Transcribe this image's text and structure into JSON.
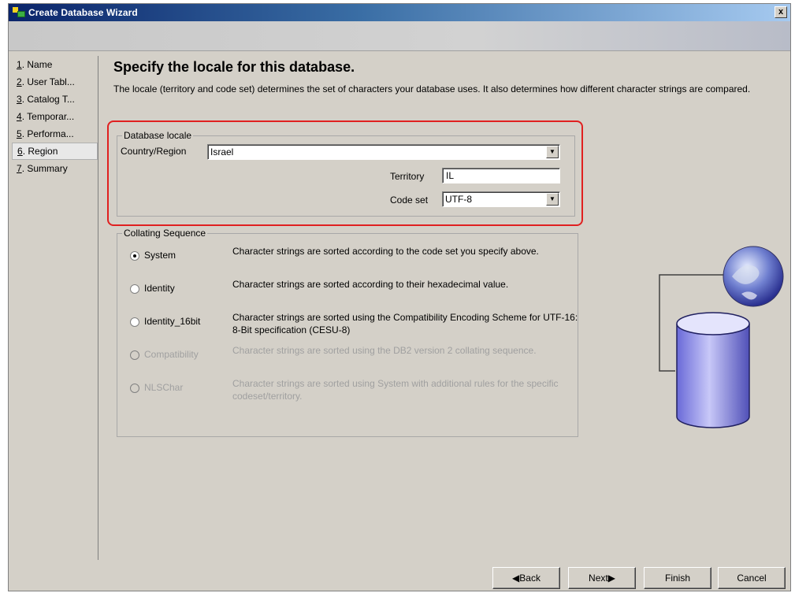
{
  "window": {
    "title": "Create Database Wizard",
    "close_label": "x"
  },
  "sidebar": {
    "items": [
      {
        "num": "1",
        "label": ". Name",
        "active": false
      },
      {
        "num": "2",
        "label": ". User Tabl...",
        "active": false
      },
      {
        "num": "3",
        "label": ". Catalog T...",
        "active": false
      },
      {
        "num": "4",
        "label": ". Temporar...",
        "active": false
      },
      {
        "num": "5",
        "label": ". Performa...",
        "active": false
      },
      {
        "num": "6",
        "label": ". Region",
        "active": true
      },
      {
        "num": "7",
        "label": ". Summary",
        "active": false
      }
    ]
  },
  "main": {
    "heading": "Specify the locale for this database.",
    "description": "The locale (territory and code set) determines the set of characters your database uses. It also determines how different character strings are compared."
  },
  "locale": {
    "legend": "Database locale",
    "country_label": "Country/Region",
    "country_value": "Israel",
    "territory_label": "Territory",
    "territory_value": "IL",
    "codeset_label": "Code set",
    "codeset_value": "UTF-8"
  },
  "collating": {
    "legend": "Collating Sequence",
    "options": [
      {
        "label": "System",
        "desc": "Character strings are sorted according to the code set you specify above.",
        "checked": true,
        "enabled": true
      },
      {
        "label": "Identity",
        "desc": "Character strings are sorted according to their hexadecimal value.",
        "checked": false,
        "enabled": true
      },
      {
        "label": "Identity_16bit",
        "desc": "Character strings are sorted using the Compatibility Encoding Scheme for UTF-16: 8-Bit specification (CESU-8)",
        "checked": false,
        "enabled": true
      },
      {
        "label": "Compatibility",
        "desc": "Character strings are sorted using the DB2 version 2 collating sequence.",
        "checked": false,
        "enabled": false
      },
      {
        "label": "NLSChar",
        "desc": "Character strings are sorted using System with additional rules for the specific codeset/territory.",
        "checked": false,
        "enabled": false
      }
    ]
  },
  "buttons": {
    "back": "Back",
    "next": "Next",
    "finish": "Finish",
    "cancel": "Cancel"
  },
  "colors": {
    "highlight": "#e02020",
    "window_bg": "#d4d0c8",
    "title_start": "#0a246a",
    "title_end": "#a6caf0"
  },
  "icons": {
    "back": "triangle-left-icon",
    "next": "triangle-right-icon",
    "illustration": "globe-database-icon"
  }
}
